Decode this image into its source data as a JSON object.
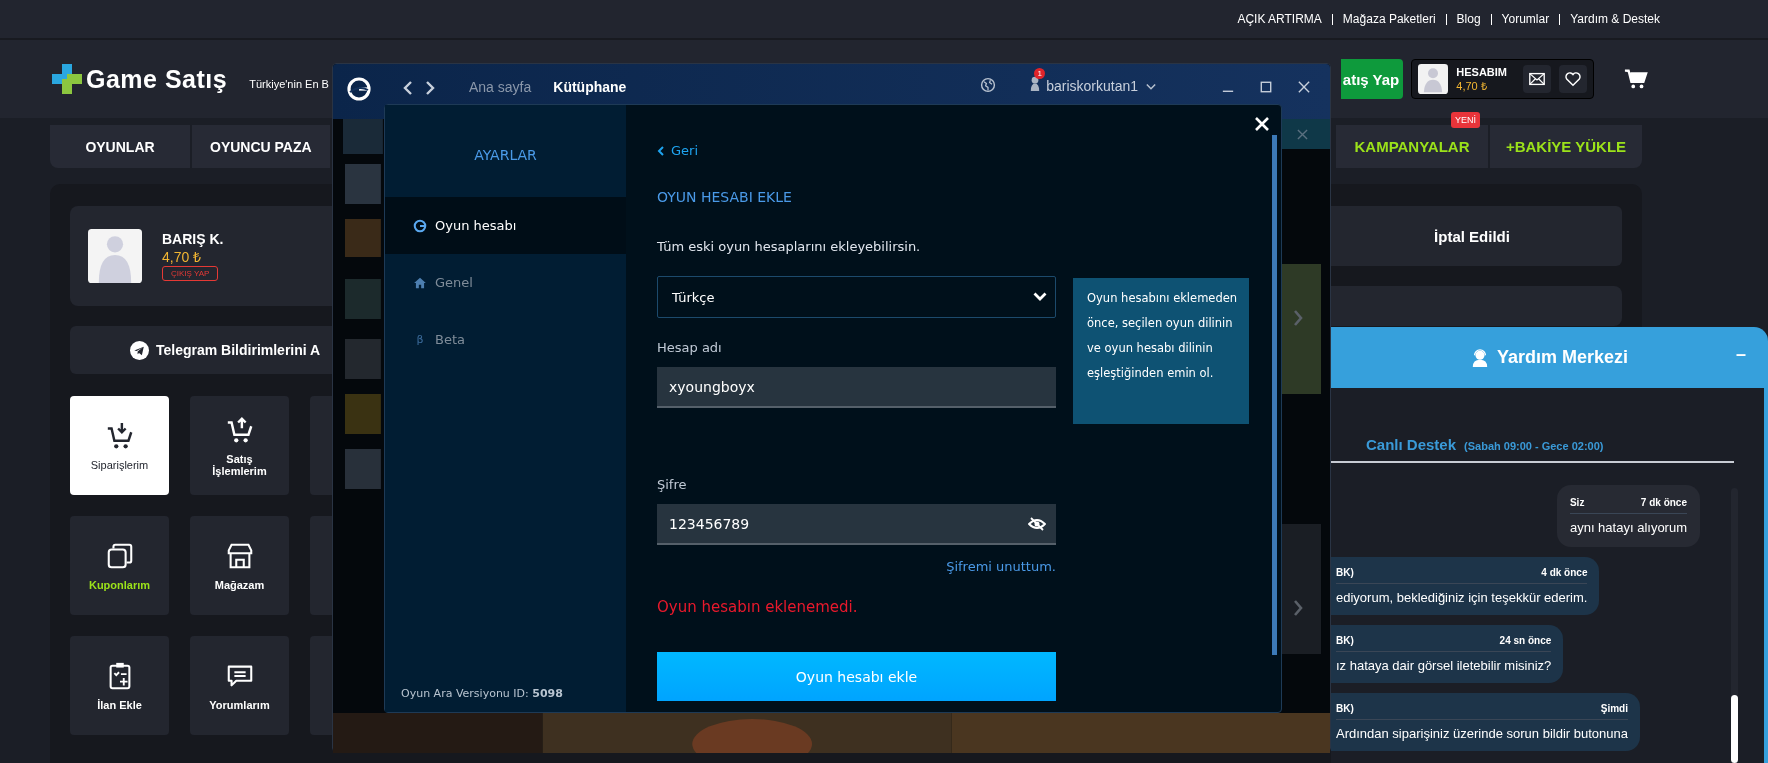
{
  "top_links": [
    "AÇIK ARTIRMA",
    "Mağaza Paketleri",
    "Blog",
    "Yorumlar",
    "Yardım & Destek"
  ],
  "header": {
    "logo_a": "Game",
    "logo_b": "Satış",
    "tagline": "Türkiye'nin En B",
    "sell_button": "atış Yap",
    "account": {
      "label": "HESABIM",
      "balance": "4,70 ₺"
    }
  },
  "nav": [
    {
      "label": "OYUNLAR",
      "highlighted": false
    },
    {
      "label": "OYUNCU PAZA",
      "highlighted": false
    },
    {
      "label": "KAMPANYALAR",
      "highlighted": true,
      "badge": "YENİ"
    },
    {
      "label": "+BAKİYE YÜKLE",
      "highlighted": true
    }
  ],
  "profile": {
    "name": "BARIŞ K.",
    "balance": "4,70 ₺",
    "logout": "ÇIKIŞ YAP"
  },
  "telegram": "Telegram Bildirimlerini A",
  "tiles": [
    {
      "label": "Siparişlerim",
      "selected": true,
      "highlighted": false
    },
    {
      "label": "Satış İşlemlerim",
      "selected": false,
      "highlighted": false
    },
    {
      "label": "Kuponlarım",
      "selected": false,
      "highlighted": true
    },
    {
      "label": "Mağazam",
      "selected": false,
      "highlighted": false
    },
    {
      "label": "İlan Ekle",
      "selected": false,
      "highlighted": false
    },
    {
      "label": "Yorumlarım",
      "selected": false,
      "highlighted": false
    }
  ],
  "status_card": "İptal Edildi",
  "app": {
    "nav": [
      {
        "label": "Ana sayfa",
        "selected": false
      },
      {
        "label": "Kütüphane",
        "selected": true
      }
    ],
    "user": {
      "name": "bariskorkutan1",
      "notifications": "1"
    }
  },
  "settings": {
    "title": "AYARLAR",
    "menu": [
      {
        "label": "Oyun hesabı",
        "selected": true
      },
      {
        "label": "Genel",
        "selected": false
      },
      {
        "label": "Beta",
        "symbol": "β",
        "selected": false
      }
    ],
    "version": "Oyun Ara Versiyonu ID: **5098**",
    "back": "Geri",
    "heading": "OYUN HESABI EKLE",
    "description": "Tüm eski oyun hesaplarını ekleyebilirsin.",
    "language": "Türkçe",
    "tooltip": "Oyun hesabını eklemeden önce, seçilen oyun dilinin ve oyun hesabı dilinin eşleştiğinden emin ol.",
    "fields": [
      {
        "label": "Hesap adı",
        "value": "xyoungboyx",
        "kind": "text"
      },
      {
        "label": "Şifre",
        "value": "123456789",
        "kind": "password"
      }
    ],
    "forgot": "Şifremi unuttum.",
    "error": "Oyun hesabın eklenemedi.",
    "submit": "Oyun hesabı ekle"
  },
  "chat": {
    "title": "Yardım Merkezi",
    "minimize": "–",
    "channel": "Canlı Destek",
    "hours": "(Sabah 09:00 - Gece 02:00)",
    "messages": [
      {
        "kind": "sent",
        "sender": "Siz",
        "time": "7 dk önce",
        "text": "aynı hatayı alıyorum"
      },
      {
        "kind": "received",
        "sender": "BK)",
        "time": "4 dk önce",
        "text": "ediyorum, beklediğiniz için teşekkür ederim."
      },
      {
        "kind": "received",
        "sender": "BK)",
        "time": "24 sn önce",
        "text": "ız hataya dair görsel iletebilir misiniz?"
      },
      {
        "kind": "received",
        "sender": "BK)",
        "time": "Şimdi",
        "text": "Ardından siparişiniz üzerinde sorun bildir butonuna"
      }
    ]
  }
}
